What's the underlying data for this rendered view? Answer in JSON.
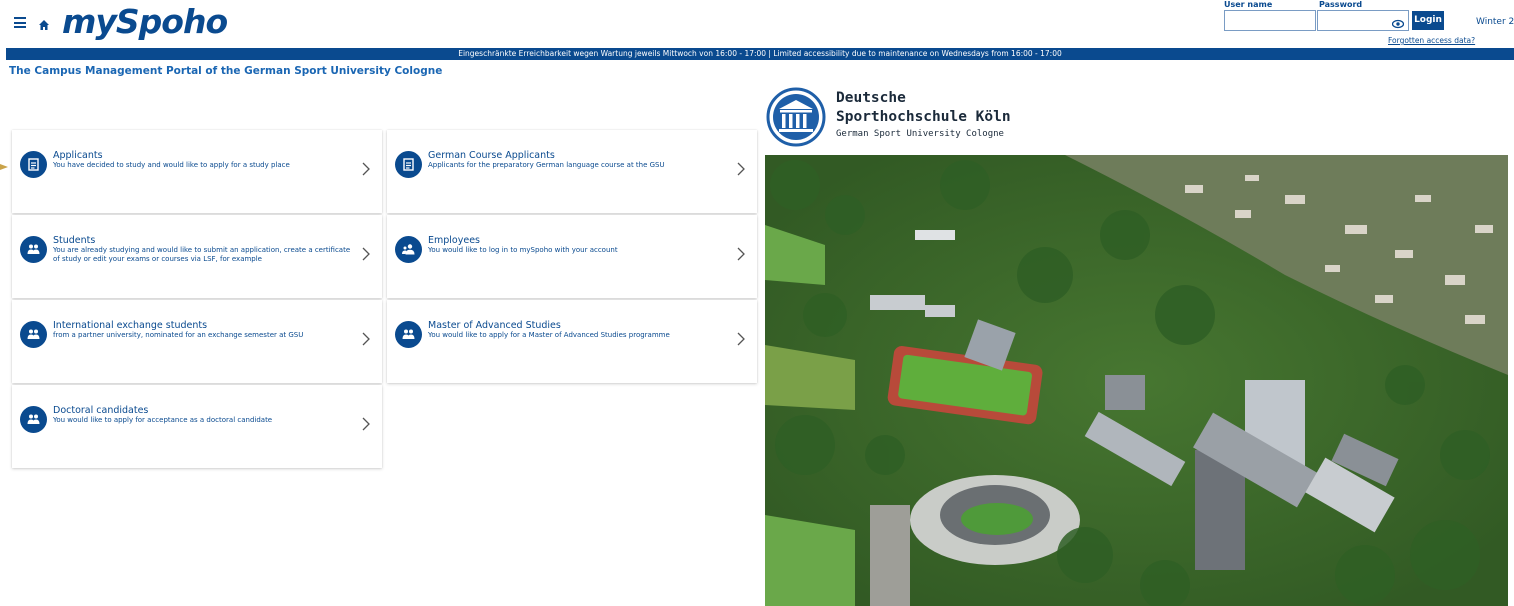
{
  "header": {
    "logo_text": "mySpoho",
    "username_label": "User name",
    "password_label": "Password",
    "username_value": "",
    "password_value": "",
    "login_label": "Login",
    "forgot_label": "Forgotten access data?",
    "semester_label": "Winter 2"
  },
  "banner": {
    "text": "Eingeschränkte Erreichbarkeit wegen Wartung jeweils Mittwoch von 16:00 - 17:00 | Limited accessibility due to maintenance on Wednesdays from 16:00 - 17:00"
  },
  "subtitle": "The Campus Management Portal of the German Sport University Cologne",
  "cards": [
    {
      "title": "Applicants",
      "description": "You have decided to study and would like to apply for a study place",
      "icon": "document-icon"
    },
    {
      "title": "German Course Applicants",
      "description": "Applicants for the preparatory German language course at the GSU",
      "icon": "document-icon"
    },
    {
      "title": "Students",
      "description": "You are already studying and would like to submit an application, create a certificate of study or edit your exams or courses via LSF, for example",
      "icon": "group-icon"
    },
    {
      "title": "Employees",
      "description": "You would like to log in to mySpoho with your account",
      "icon": "person-icon"
    },
    {
      "title": "International exchange students",
      "description": "from a partner university, nominated for an exchange semester at GSU",
      "icon": "group-icon"
    },
    {
      "title": "Master of Advanced Studies",
      "description": "You would like to apply for a Master of Advanced Studies programme",
      "icon": "group-icon"
    },
    {
      "title": "Doctoral candidates",
      "description": "You would like to apply for acceptance as a doctoral candidate",
      "icon": "group-icon"
    }
  ],
  "university": {
    "name_line1": "Deutsche",
    "name_line2": "Sporthochschule Köln",
    "name_line3": "German Sport University Cologne"
  },
  "colors": {
    "brand": "#0a4a8f",
    "link": "#1a66b3"
  }
}
